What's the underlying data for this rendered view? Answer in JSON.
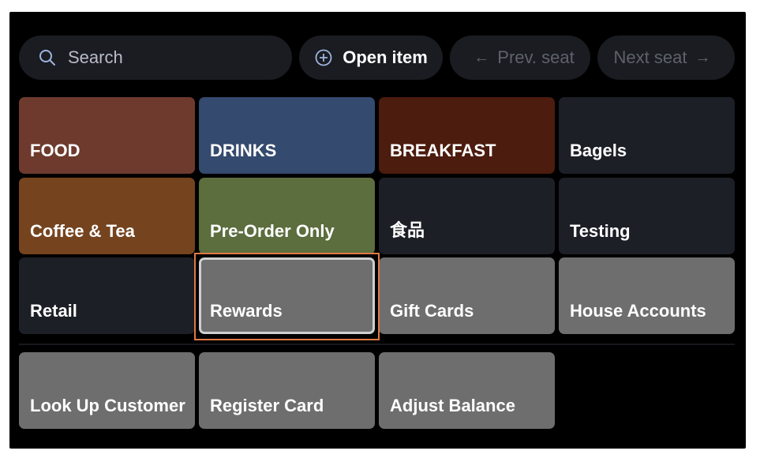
{
  "toolbar": {
    "search_placeholder": "Search",
    "open_item_label": "Open item",
    "prev_seat_label": "Prev. seat",
    "next_seat_label": "Next seat",
    "left_arrow": "←",
    "right_arrow": "→"
  },
  "categories": [
    {
      "label": "FOOD",
      "color": "#6e3a2e"
    },
    {
      "label": "DRINKS",
      "color": "#344a6e"
    },
    {
      "label": "BREAKFAST",
      "color": "#4c1c0e"
    },
    {
      "label": "Bagels",
      "color": "#1c1f26"
    },
    {
      "label": "Coffee & Tea",
      "color": "#75441f"
    },
    {
      "label": "Pre-Order Only",
      "color": "#5c6d3e"
    },
    {
      "label": "食品",
      "color": "#1c1f26"
    },
    {
      "label": "Testing",
      "color": "#1c1f26"
    },
    {
      "label": "Retail",
      "color": "#1c1f26"
    },
    {
      "label": "Rewards",
      "color": "#6e6e6e",
      "selected": true
    },
    {
      "label": "Gift Cards",
      "color": "#6e6e6e"
    },
    {
      "label": "House Accounts",
      "color": "#6e6e6e"
    }
  ],
  "actions": [
    {
      "label": "Look Up Customer",
      "color": "#6e6e6e"
    },
    {
      "label": "Register Card",
      "color": "#6e6e6e"
    },
    {
      "label": "Adjust Balance",
      "color": "#6e6e6e"
    }
  ],
  "icons": {
    "search": "search-icon",
    "open_item": "plus-circle-icon"
  },
  "colors": {
    "background": "#000000",
    "focus_ring": "#e07a44"
  }
}
